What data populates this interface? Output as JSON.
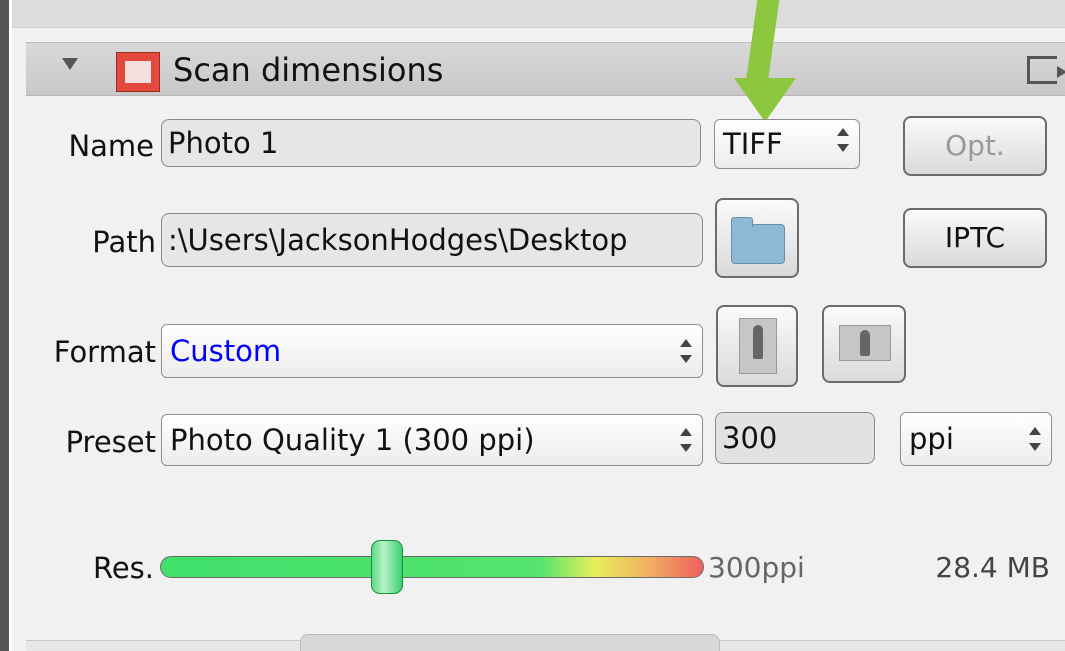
{
  "section": {
    "title": "Scan dimensions",
    "icons": {
      "expand": "triangle-down-icon",
      "scan": "scan-dimensions-icon",
      "collapse": "panel-collapse-icon"
    }
  },
  "name_row": {
    "label": "Name",
    "value": "Photo 1",
    "file_type": "TIFF",
    "options_label": "Opt."
  },
  "path_row": {
    "label": "Path",
    "value": ":\\Users\\JacksonHodges\\Desktop",
    "iptc_label": "IPTC",
    "folder_icon": "folder-icon"
  },
  "format_row": {
    "label": "Format",
    "value": "Custom",
    "value_color": "#0000ff",
    "portrait_icon": "portrait-orientation-icon",
    "landscape_icon": "landscape-orientation-icon"
  },
  "preset_row": {
    "label": "Preset",
    "value": "Photo Quality 1 (300 ppi)",
    "resolution": "300",
    "unit": "ppi"
  },
  "res_row": {
    "label": "Res.",
    "slider_value": 0.42,
    "value_text": "300ppi",
    "size_text": "28.4 MB"
  },
  "annotation": {
    "color": "#8dc63f",
    "icon": "green-arrow-icon"
  }
}
